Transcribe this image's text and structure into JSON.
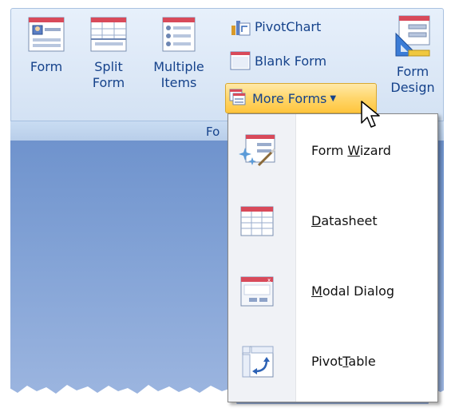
{
  "ribbon": {
    "group_label": "Fo",
    "buttons": {
      "form": "Form",
      "split_form_line1": "Split",
      "split_form_line2": "Form",
      "multiple_items_line1": "Multiple",
      "multiple_items_line2": "Items",
      "pivot_chart": "PivotChart",
      "blank_form": "Blank Form",
      "more_forms": "More Forms",
      "form_design_line1": "Form",
      "form_design_line2": "Design"
    }
  },
  "menu": {
    "items": [
      {
        "pre": "Form ",
        "key": "W",
        "post": "izard",
        "icon": "form-wizard-icon"
      },
      {
        "pre": "",
        "key": "D",
        "post": "atasheet",
        "icon": "datasheet-icon"
      },
      {
        "pre": "",
        "key": "M",
        "post": "odal Dialog",
        "icon": "modal-dialog-icon"
      },
      {
        "pre": "Pivot",
        "key": "T",
        "post": "able",
        "icon": "pivottable-icon"
      }
    ]
  },
  "colors": {
    "ribbon_text": "#15428b",
    "highlight": "#ffd66b",
    "workarea": "#83a3d6"
  }
}
